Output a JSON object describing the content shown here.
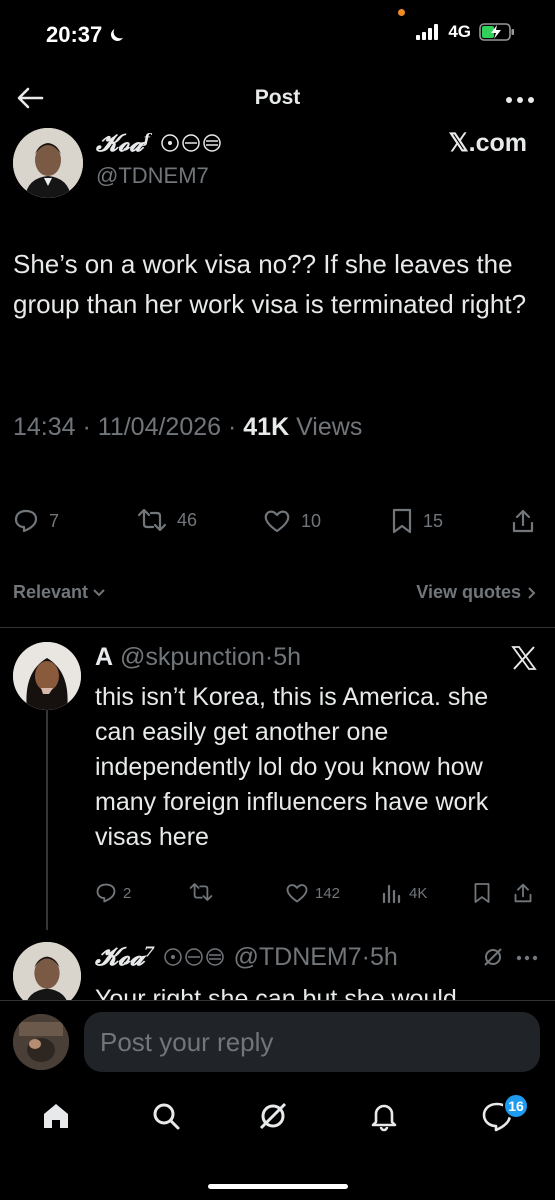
{
  "status_bar": {
    "time": "20:37",
    "network": "4G"
  },
  "header": {
    "title": "Post"
  },
  "post": {
    "author_name": "𝓚𝓸𝓪ᶠ",
    "author_handle": "@TDNEM7",
    "source_label": "𝕏.com",
    "text": "She’s on a work visa no?? If she leaves the group than her work visa is terminated right?",
    "time": "14:34 · 11/04/2026 · ",
    "views_count": "41K",
    "views_label": " Views",
    "stats": {
      "replies": "7",
      "reposts": "46",
      "likes": "10",
      "bookmarks": "15"
    }
  },
  "sort": {
    "label": "Relevant",
    "view_quotes": "View quotes"
  },
  "replies": [
    {
      "name": "A",
      "handle": "@skpunction",
      "time": "·5h",
      "text": "this isn’t Korea, this is America. she can easily get another one independently lol do you know how many foreign influencers have work visas here",
      "stats": {
        "replies": "2",
        "reposts": "",
        "likes": "142",
        "views": "4K"
      }
    },
    {
      "name": "𝓚𝓸𝓪⁷",
      "handle": "@TDNEM7",
      "time": "·5h",
      "text": "Your right she can but she would"
    }
  ],
  "composer": {
    "placeholder": "Post your reply"
  },
  "nav": {
    "badge": "16"
  },
  "colors": {
    "background": "#000000",
    "text": "#e7e9ea",
    "muted": "#71767b",
    "accent": "#1d9bf0"
  }
}
